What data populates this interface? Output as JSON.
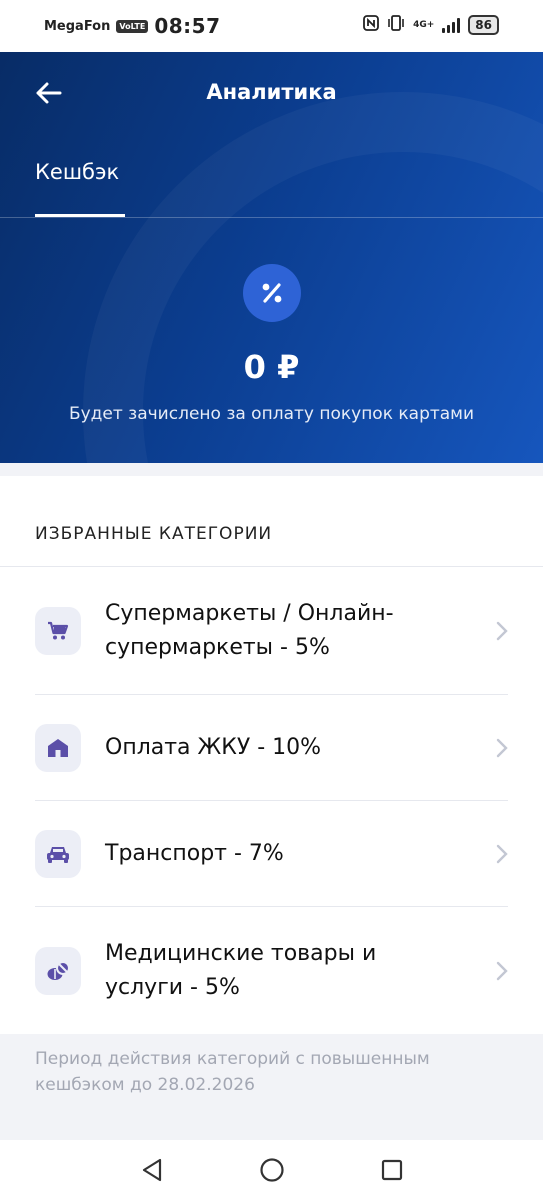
{
  "status_bar": {
    "carrier": "MegaFon",
    "volte": "VoLTE",
    "time": "08:57",
    "network": "4G+",
    "battery": "86"
  },
  "header": {
    "title": "Аналитика",
    "back_icon": "arrow-left-icon"
  },
  "tabs": [
    {
      "label": "Кешбэк",
      "active": true
    }
  ],
  "cashback": {
    "icon": "percent-icon",
    "amount": "0 ₽",
    "subtitle": "Будет зачислено за оплату покупок картами"
  },
  "favorites": {
    "heading": "ИЗБРАННЫЕ КАТЕГОРИИ",
    "items": [
      {
        "icon": "cart-icon",
        "label": "Супермаркеты / Онлайн-супермаркеты - 5%"
      },
      {
        "icon": "house-icon",
        "label": "Оплата ЖКУ - 10%"
      },
      {
        "icon": "car-icon",
        "label": "Транспорт - 7%"
      },
      {
        "icon": "pills-icon",
        "label": "Медицинские товары и услуги - 5%"
      }
    ]
  },
  "footnote": "Период действия категорий с повышенным кешбэком до 28.02.2026",
  "colors": {
    "hero_dark": "#082c66",
    "hero_light": "#1656bd",
    "icon_purple": "#5b4fa8",
    "badge": "#2e63d6"
  }
}
